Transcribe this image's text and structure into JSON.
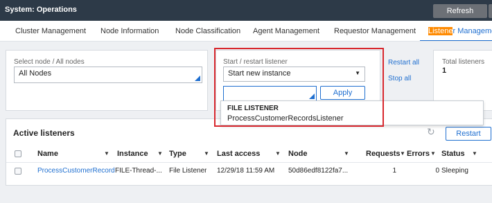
{
  "header": {
    "title": "System: Operations",
    "refresh_label": "Refresh"
  },
  "tabs": [
    {
      "label": "Cluster Management"
    },
    {
      "label": "Node Information"
    },
    {
      "label": "Node Classification"
    },
    {
      "label": "Agent Management"
    },
    {
      "label": "Requestor Management"
    },
    {
      "label_highlight": "Listene",
      "label_rest": "r Manageme"
    }
  ],
  "node_card": {
    "label": "Select node / All nodes",
    "value": "All Nodes"
  },
  "listener_card": {
    "label": "Start / restart listener",
    "select_value": "Start new instance",
    "input_value": "",
    "apply_label": "Apply",
    "restart_all_label": "Restart all",
    "stop_all_label": "Stop all"
  },
  "total_card": {
    "label": "Total listeners",
    "value": "1"
  },
  "popup": {
    "heading": "FILE LISTENER",
    "item": "ProcessCustomerRecordsListener"
  },
  "active": {
    "title": "Active listeners",
    "restart_label": "Restart",
    "columns": [
      "Name",
      "Instance",
      "Type",
      "Last access",
      "Node",
      "Requests",
      "Errors",
      "Status"
    ],
    "rows": [
      {
        "name": "ProcessCustomerRecords",
        "instance": "FILE-Thread-...",
        "type": "File Listener",
        "last_access": "12/29/18 11:59 AM",
        "node": "50d86edf8122fa7...",
        "requests": "1",
        "errors": "0",
        "status": "Sleeping"
      }
    ]
  },
  "colors": {
    "accent": "#1f6fd0",
    "header_bg": "#2d3a48",
    "highlight": "#ff8a00",
    "annotation": "#d8272d"
  }
}
